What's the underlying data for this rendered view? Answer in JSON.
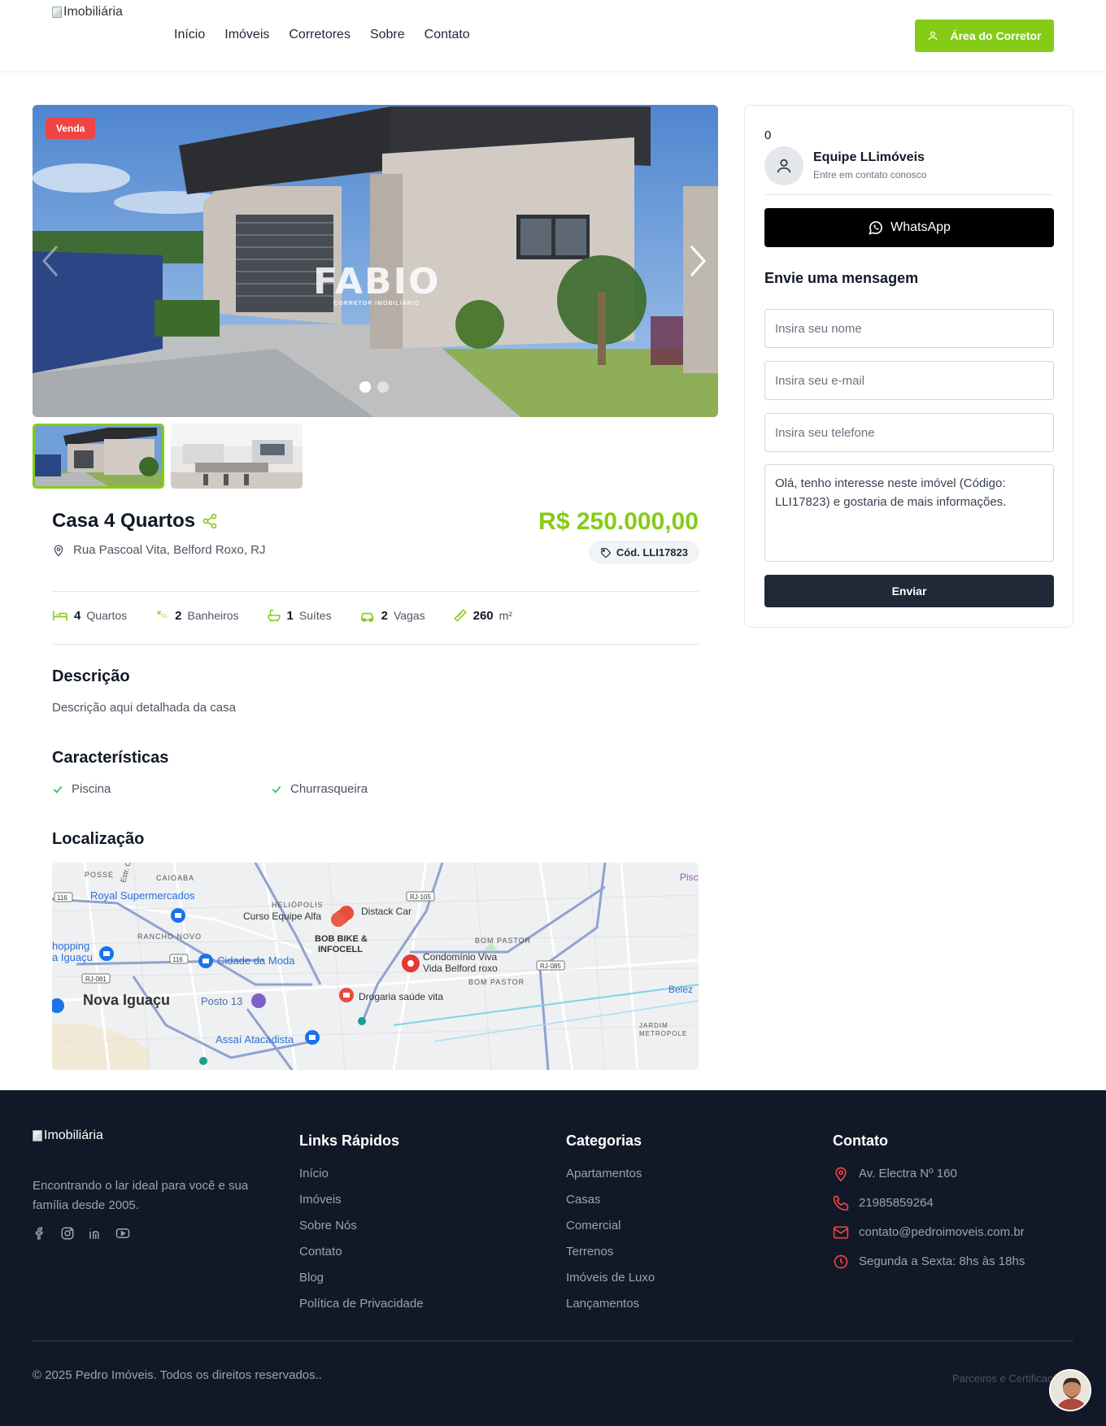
{
  "header": {
    "logo_alt": "Imobiliária",
    "nav": [
      "Início",
      "Imóveis",
      "Corretores",
      "Sobre",
      "Contato"
    ],
    "broker_button": "Área do Corretor",
    "accent": "#84cc16"
  },
  "gallery": {
    "badge": "Venda",
    "watermark_main": "FABIO",
    "watermark_sub": "CORRETOR IMOBILIÁRIO",
    "slide_count": 2,
    "active_slide": 1
  },
  "property": {
    "title": "Casa 4 Quartos",
    "address": "Rua Pascoal Vita, Belford Roxo, RJ",
    "price": "R$ 250.000,00",
    "code": "Cód. LLI17823",
    "features": [
      {
        "icon": "bed-icon",
        "value": "4",
        "label": "Quartos"
      },
      {
        "icon": "shower-icon",
        "value": "2",
        "label": "Banheiros"
      },
      {
        "icon": "bathtub-icon",
        "value": "1",
        "label": "Suítes"
      },
      {
        "icon": "car-icon",
        "value": "2",
        "label": "Vagas"
      },
      {
        "icon": "ruler-icon",
        "value": "260",
        "label": "m²"
      }
    ],
    "description_title": "Descrição",
    "description": "Descrição aqui detalhada da casa",
    "characteristics_title": "Características",
    "characteristics": [
      "Piscina",
      "Churrasqueira"
    ],
    "location_title": "Localização"
  },
  "map": {
    "labels": [
      "POSSE",
      "CAIOABA",
      "Royal Supermercados",
      "HELIÓPOLIS",
      "Curso Equipe Alfa",
      "Distack Car",
      "RANCHO NOVO",
      "BOB BIKE &",
      "INFOCELL",
      "BOM PASTOR",
      "hopping",
      "a Iguaçu",
      "Cidade da Moda",
      "Condomínio Viva",
      "Vida Belford roxo",
      "BOM PASTOR",
      "Nova Iguaçu",
      "Posto 13",
      "Drogaria saúde vita",
      "Belez",
      "JARDIM",
      "METROPOLE",
      "Assaí Atacadista",
      "Pisc",
      "RJ-105",
      "RJ-085",
      "RJ-081",
      "116",
      "116",
      "Estr. C"
    ]
  },
  "contact_card": {
    "counter": "0",
    "agent_name": "Equipe LLimóveis",
    "agent_subtitle": "Entre em contato conosco",
    "whatsapp_label": "WhatsApp",
    "form_title": "Envie uma mensagem",
    "name_placeholder": "Insira seu nome",
    "email_placeholder": "Insira seu e-mail",
    "phone_placeholder": "Insira seu telefone",
    "message_value": "Olá, tenho interesse neste imóvel (Código: LLI17823) e gostaria de mais informações.",
    "send_label": "Enviar"
  },
  "footer": {
    "logo_alt": "Imobiliária",
    "tagline": "Encontrando o lar ideal para você e sua família desde 2005.",
    "social": [
      "facebook-icon",
      "instagram-icon",
      "linkedin-icon",
      "youtube-icon"
    ],
    "quick_links_title": "Links Rápidos",
    "quick_links": [
      "Início",
      "Imóveis",
      "Sobre Nós",
      "Contato",
      "Blog",
      "Política de Privacidade"
    ],
    "categories_title": "Categorias",
    "categories": [
      "Apartamentos",
      "Casas",
      "Comercial",
      "Terrenos",
      "Imóveis de Luxo",
      "Lançamentos"
    ],
    "contact_title": "Contato",
    "address": "Av. Electra Nº 160",
    "phone": "21985859264",
    "email": "contato@pedroimoveis.com.br",
    "hours": "Segunda a Sexta: 8hs às 18hs",
    "copyright": "© 2025 Pedro Imóveis. Todos os direitos reservados..",
    "partners": "Parceiros e Certificações"
  }
}
